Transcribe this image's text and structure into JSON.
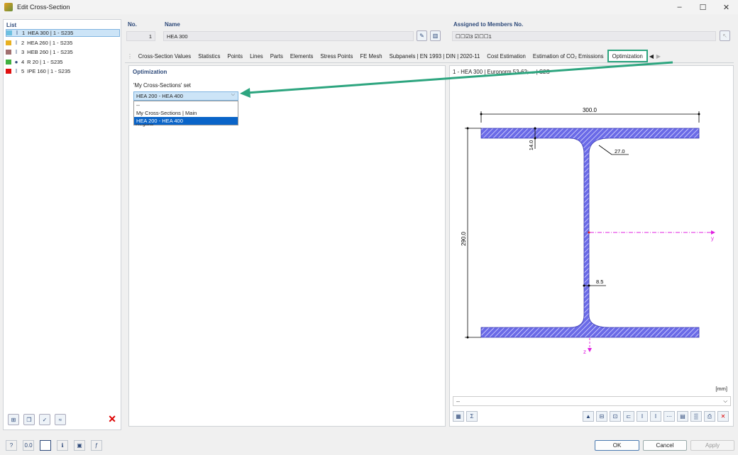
{
  "window": {
    "title": "Edit Cross-Section",
    "controls": [
      "–",
      "☐",
      "✕"
    ]
  },
  "list": {
    "header": "List",
    "items": [
      {
        "no": "1",
        "label": "HEA 300 | 1 - S235",
        "color": "#6cc0e0",
        "icon": "I-section-icon",
        "glyph": "I"
      },
      {
        "no": "2",
        "label": "HEA 260 | 1 - S235",
        "color": "#e8b020",
        "icon": "I-section-icon",
        "glyph": "I"
      },
      {
        "no": "3",
        "label": "HEB 260 | 1 - S235",
        "color": "#a07070",
        "icon": "I-section-icon",
        "glyph": "I"
      },
      {
        "no": "4",
        "label": "R 20 | 1 - S235",
        "color": "#40b040",
        "icon": "round-bar-icon",
        "glyph": "●"
      },
      {
        "no": "5",
        "label": "IPE 160 | 1 - S235",
        "color": "#e01010",
        "icon": "I-section-icon",
        "glyph": "I"
      }
    ]
  },
  "fields": {
    "no_label": "No.",
    "no_value": "1",
    "name_label": "Name",
    "name_value": "HEA 300",
    "assigned_label": "Assigned to Members No.",
    "assigned_value": "☐☐☑3 ☑☐☐1"
  },
  "tabs": [
    "Cross-Section Values",
    "Statistics",
    "Points",
    "Lines",
    "Parts",
    "Elements",
    "Stress Points",
    "FE Mesh",
    "Subpanels | EN 1993 | DIN | 2020-11",
    "Cost Estimation",
    "Estimation of CO₂ Emissions",
    "Optimization"
  ],
  "active_tab": "Optimization",
  "optimization": {
    "header": "Optimization",
    "set_label": "'My Cross-Sections' set",
    "combo_value": "HEA 200 - HEA 400",
    "options": [
      "--",
      "My Cross-Sections | Main",
      "HEA 200 - HEA 400"
    ],
    "selected_option": "HEA 200 - HEA 400",
    "ghost_text": "Regular"
  },
  "graphic": {
    "title": "1 - HEA 300 | Euronorm 53-62; ... | S2S",
    "dims": {
      "width": "300.0",
      "height": "290.0",
      "flange": "14.0",
      "radius": "27.0",
      "web": "8.5"
    },
    "axis_y": "y",
    "axis_z": "z",
    "unit": "[mm]",
    "bottom_combo": "--",
    "section_color": "#6a6ae8"
  },
  "buttons": {
    "ok": "OK",
    "cancel": "Cancel",
    "apply": "Apply"
  }
}
